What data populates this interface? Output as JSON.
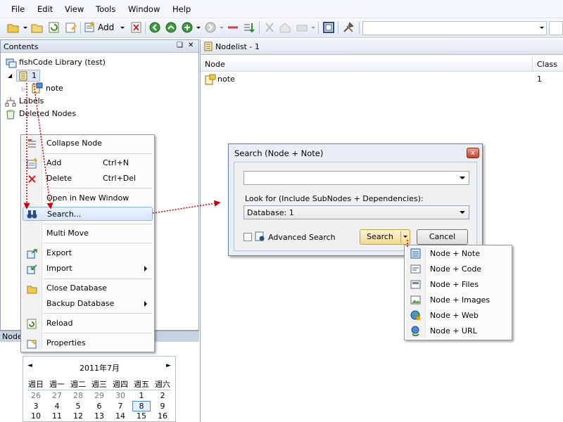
{
  "menubar": [
    "File",
    "Edit",
    "View",
    "Tools",
    "Window",
    "Help"
  ],
  "toolbar": {
    "add_label": "Add"
  },
  "contents": {
    "title": "Contents",
    "pin": "❑",
    "close": "✕",
    "tree": {
      "root": "fishCode Library (test)",
      "node1": "1",
      "note": "note",
      "labels": "Labels",
      "deleted": "Deleted Nodes"
    },
    "bottom_tab": "Node"
  },
  "nodelist": {
    "tab_title": "Nodelist - 1",
    "columns": [
      "Node",
      "Class"
    ],
    "rows": [
      {
        "node": "note",
        "class": "1"
      }
    ]
  },
  "context_menu": {
    "collapse": "Collapse Node",
    "add": "Add",
    "add_shortcut": "Ctrl+N",
    "delete": "Delete",
    "delete_shortcut": "Ctrl+Del",
    "open_new_window": "Open in New Window",
    "search": "Search...",
    "multi_move": "Multi Move",
    "export": "Export",
    "import": "Import",
    "close_db": "Close Database",
    "backup_db": "Backup Database",
    "reload": "Reload",
    "properties": "Properties"
  },
  "dialog": {
    "title": "Search (Node + Note)",
    "close_glyph": "x",
    "search_value": "",
    "look_for_label": "Look for (Include SubNodes + Dependencies):",
    "database_value": "Database: 1",
    "advanced_label": "Advanced Search",
    "search_button": "Search",
    "cancel_button": "Cancel"
  },
  "search_submenu": [
    "Node + Note",
    "Node + Code",
    "Node + Files",
    "Node + Images",
    "Node + Web",
    "Node + URL"
  ],
  "calendar": {
    "prev": "◄",
    "next": "►",
    "title": "2011年7月",
    "weekdays": [
      "週日",
      "週一",
      "週二",
      "週三",
      "週四",
      "週五",
      "週六"
    ],
    "week1": [
      "26",
      "27",
      "28",
      "29",
      "30",
      "1",
      "2"
    ],
    "week2": [
      "3",
      "4",
      "5",
      "6",
      "7",
      "8",
      "9"
    ],
    "week3": [
      "10",
      "11",
      "12",
      "13",
      "14",
      "15",
      "16"
    ],
    "selected": "8"
  }
}
